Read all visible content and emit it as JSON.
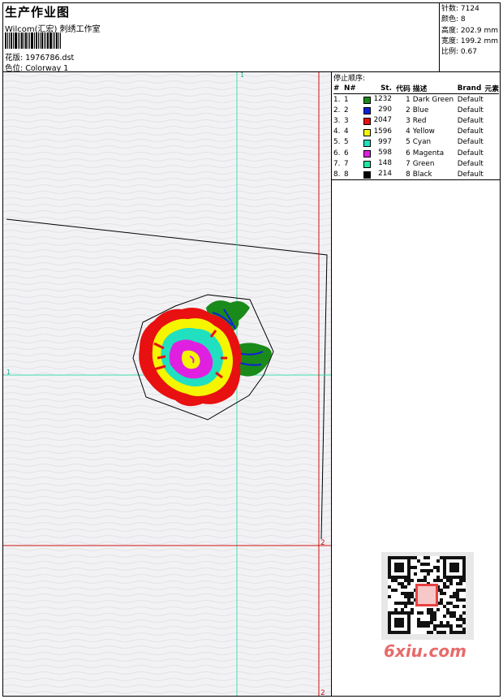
{
  "header": {
    "title": "生产作业图",
    "company": "Wilcom(汇宏) 刺绣工作室",
    "design_label": "花版: 1976786.dst",
    "colorway_label": "色位: Colorway 1"
  },
  "stats": {
    "stitches": "针数: 7124",
    "colors": "颜色: 8",
    "height": "高度: 202.9 mm",
    "width": "宽度: 199.2 mm",
    "scale": "比例: 0.67"
  },
  "guides": {
    "top_v_label": "1",
    "left_h_label": "1",
    "right_h_label": "2",
    "bottom_v_label": "2"
  },
  "stop_sequence": {
    "label": "停止顺序:",
    "headers": [
      "#",
      "N#",
      "St.",
      "代码",
      "描述",
      "Brand",
      "元素"
    ],
    "rows": [
      {
        "idx": "1.",
        "n": "1",
        "color": "#1a8a1a",
        "st": "1232",
        "code": "1",
        "desc": "Dark Green",
        "brand": "Default",
        "elem": ""
      },
      {
        "idx": "2.",
        "n": "2",
        "color": "#1020d8",
        "st": "290",
        "code": "2",
        "desc": "Blue",
        "brand": "Default",
        "elem": ""
      },
      {
        "idx": "3.",
        "n": "3",
        "color": "#e81010",
        "st": "2047",
        "code": "3",
        "desc": "Red",
        "brand": "Default",
        "elem": ""
      },
      {
        "idx": "4.",
        "n": "4",
        "color": "#f5f500",
        "st": "1596",
        "code": "4",
        "desc": "Yellow",
        "brand": "Default",
        "elem": ""
      },
      {
        "idx": "5.",
        "n": "5",
        "color": "#20e0c0",
        "st": "997",
        "code": "5",
        "desc": "Cyan",
        "brand": "Default",
        "elem": ""
      },
      {
        "idx": "6.",
        "n": "6",
        "color": "#e020e0",
        "st": "598",
        "code": "6",
        "desc": "Magenta",
        "brand": "Default",
        "elem": ""
      },
      {
        "idx": "7.",
        "n": "7",
        "color": "#20e8a0",
        "st": "148",
        "code": "7",
        "desc": "Green",
        "brand": "Default",
        "elem": ""
      },
      {
        "idx": "8.",
        "n": "8",
        "color": "#000000",
        "st": "214",
        "code": "8",
        "desc": "Black",
        "brand": "Default",
        "elem": ""
      }
    ]
  },
  "watermark": "6xiu.com",
  "colors": {
    "canvas": "#f2f2f4",
    "guide_cyan": "#40e0b0",
    "guide_red": "#d01010"
  }
}
